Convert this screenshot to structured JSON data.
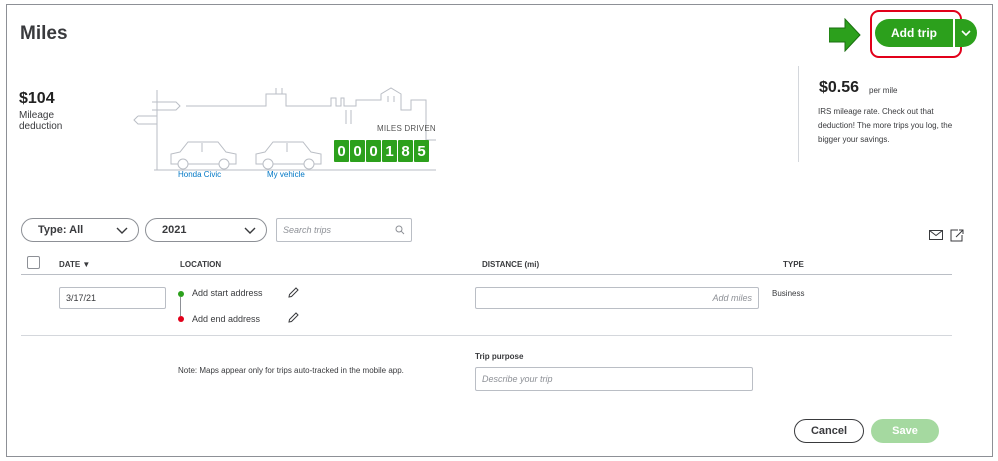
{
  "page": {
    "title": "Miles"
  },
  "header": {
    "add_trip_label": "Add trip",
    "accent": "#2ca01c",
    "highlight": "#e2001a"
  },
  "deduction": {
    "amount": "$104",
    "label": "Mileage deduction"
  },
  "illustration": {
    "vehicles": [
      "Honda Civic",
      "My vehicle"
    ],
    "miles_driven_label": "MILES DRIVEN",
    "digits": [
      "0",
      "0",
      "0",
      "1",
      "8",
      "5"
    ]
  },
  "irs": {
    "rate": "$0.56",
    "per": "per mile",
    "description": "IRS mileage rate. Check out that deduction! The more trips you log, the bigger your savings."
  },
  "filters": {
    "type_label": "Type: All",
    "year_label": "2021",
    "search_placeholder": "Search trips"
  },
  "table": {
    "columns": {
      "date": "DATE",
      "location": "LOCATION",
      "distance": "DISTANCE (mi)",
      "type": "TYPE"
    },
    "row": {
      "date_value": "3/17/21",
      "start_address": "Add start address",
      "end_address": "Add end address",
      "miles_placeholder": "Add miles",
      "type_value": "Business",
      "note": "Note: Maps appear only for trips auto-tracked in the mobile app.",
      "trip_purpose_label": "Trip purpose",
      "trip_purpose_placeholder": "Describe your trip"
    }
  },
  "footer": {
    "cancel_label": "Cancel",
    "save_label": "Save"
  }
}
